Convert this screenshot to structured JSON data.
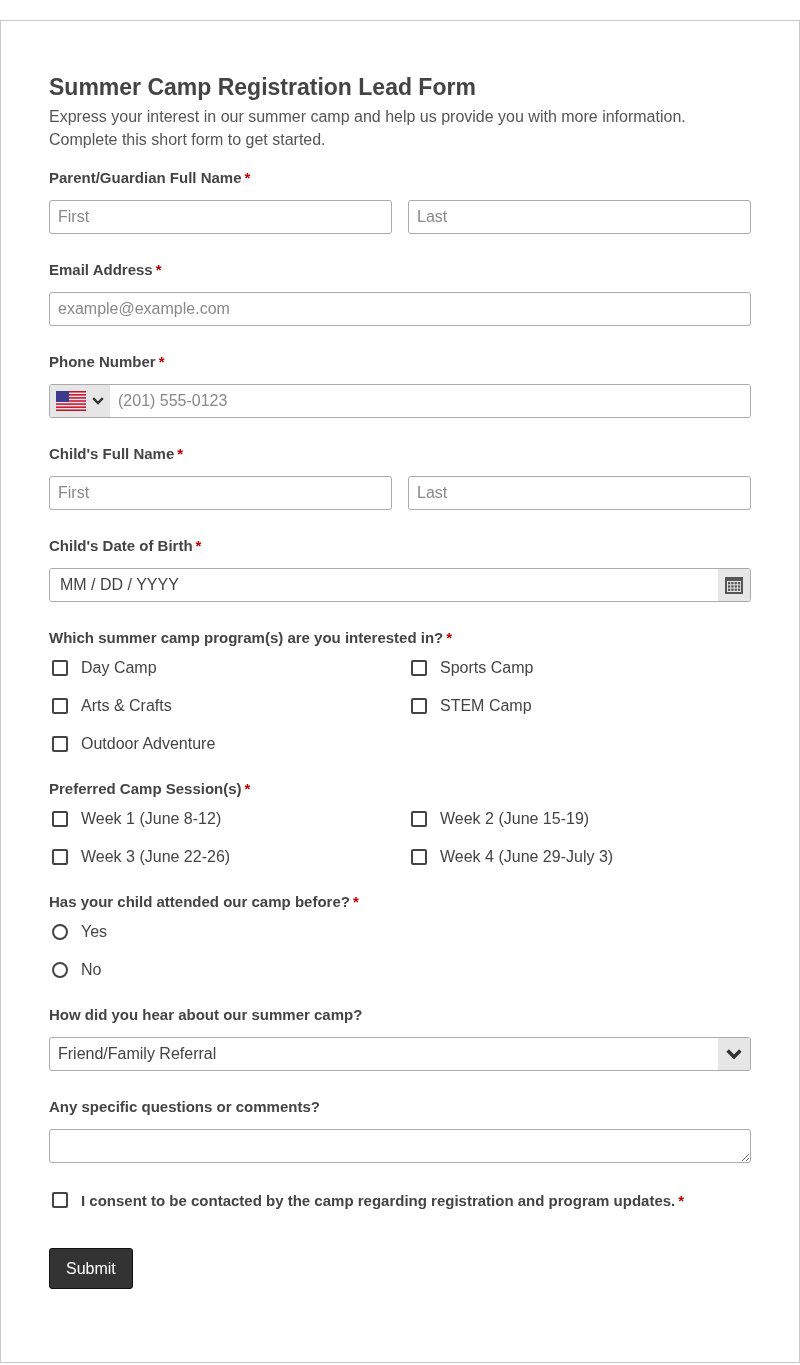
{
  "form": {
    "title": "Summer Camp Registration Lead Form",
    "description": [
      "Express your interest in our summer camp and help us provide you with more information.",
      "Complete this short form to get started."
    ],
    "fields": [
      {
        "kind": "name_pair",
        "label": "Parent/Guardian Full Name",
        "required_mark": "*",
        "inputs": [
          {
            "placeholder": "First"
          },
          {
            "placeholder": "Last"
          }
        ]
      },
      {
        "kind": "text",
        "label": "Email Address",
        "required_mark": "*",
        "placeholder": "example@example.com"
      },
      {
        "kind": "phone",
        "label": "Phone Number",
        "required_mark": "*",
        "placeholder": "(201) 555-0123"
      },
      {
        "kind": "name_pair",
        "label": "Child's Full Name",
        "required_mark": "*",
        "inputs": [
          {
            "placeholder": "First"
          },
          {
            "placeholder": "Last"
          }
        ]
      },
      {
        "kind": "date",
        "label": "Child's Date of Birth",
        "required_mark": "*",
        "placeholder": "MM / DD / YYYY"
      },
      {
        "kind": "checkbox_group",
        "label": "Which summer camp program(s) are you interested in?",
        "required_mark": "*",
        "options": [
          {
            "label": "Day Camp",
            "checked": false
          },
          {
            "label": "Sports Camp",
            "checked": false
          },
          {
            "label": "Arts & Crafts",
            "checked": false
          },
          {
            "label": "STEM Camp",
            "checked": false
          },
          {
            "label": "Outdoor Adventure",
            "checked": false
          }
        ]
      },
      {
        "kind": "checkbox_group",
        "label": "Preferred Camp Session(s)",
        "required_mark": "*",
        "options": [
          {
            "label": "Week 1 (June 8-12)",
            "checked": false
          },
          {
            "label": "Week 2 (June 15-19)",
            "checked": false
          },
          {
            "label": "Week 3 (June 22-26)",
            "checked": false
          },
          {
            "label": "Week 4 (June 29-July 3)",
            "checked": false
          }
        ]
      },
      {
        "kind": "radio_group",
        "label": "Has your child attended our camp before?",
        "required_mark": "*",
        "options": [
          {
            "label": "Yes",
            "selected": false
          },
          {
            "label": "No",
            "selected": false
          }
        ]
      },
      {
        "kind": "select",
        "label": "How did you hear about our summer camp?",
        "value": "Friend/Family Referral"
      },
      {
        "kind": "textarea",
        "label": "Any specific questions or comments?"
      }
    ],
    "consent": {
      "label": "I consent to be contacted by the camp regarding registration and program updates.",
      "required_mark": "*",
      "checked": false
    },
    "submit": "Submit"
  }
}
